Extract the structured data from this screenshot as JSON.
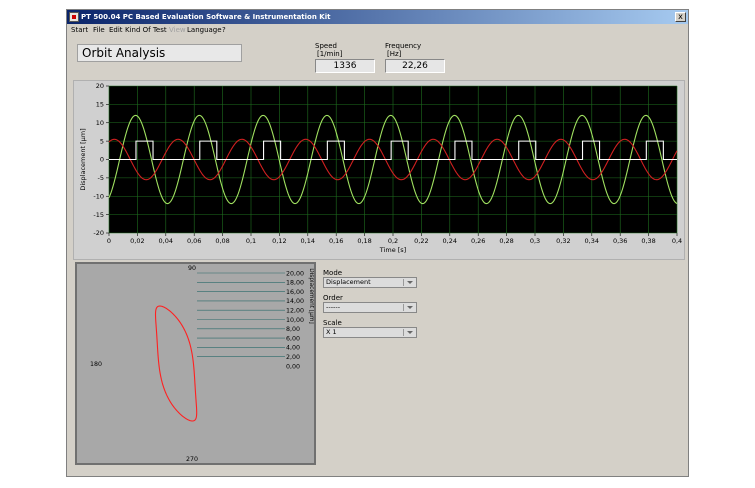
{
  "window": {
    "title": "PT 500.04 PC Based Evaluation Software & Instrumentation Kit",
    "close_label": "x"
  },
  "menu": [
    "Start",
    "File",
    "Edit",
    "Kind Of Test",
    "View",
    "Language",
    "?"
  ],
  "page_title": "Orbit Analysis",
  "indicators": {
    "speed": {
      "label": "Speed",
      "unit": "[1/min]",
      "value": "1336"
    },
    "frequency": {
      "label": "Frequency",
      "unit": "[Hz]",
      "value": "22,26"
    }
  },
  "controls": {
    "mode": {
      "label": "Mode",
      "value": "Displacement"
    },
    "order": {
      "label": "Order",
      "value": "------"
    },
    "scale": {
      "label": "Scale",
      "value": "X  1"
    }
  },
  "colors": {
    "plot_bg": "#000000",
    "grid": "#1f6f1f",
    "series_green": "#a0e060",
    "series_red": "#d02020",
    "series_white": "#ffffff",
    "orbit": "#ff2020"
  },
  "chart_data": [
    {
      "type": "line",
      "xlabel": "Time [s]",
      "ylabel": "Displacement [µm]",
      "xlim": [
        0,
        0.4
      ],
      "ylim": [
        -20,
        20
      ],
      "x_ticks": [
        "0",
        "0,02",
        "0,04",
        "0,06",
        "0,08",
        "0,1",
        "0,12",
        "0,14",
        "0,16",
        "0,18",
        "0,2",
        "0,22",
        "0,24",
        "0,26",
        "0,28",
        "0,3",
        "0,32",
        "0,34",
        "0,36",
        "0,38",
        "0,4"
      ],
      "y_ticks": [
        "20",
        "15",
        "10",
        "5",
        "0",
        "-5",
        "-10",
        "-15",
        "-20"
      ],
      "grid": true,
      "series": [
        {
          "color": "#a0e060",
          "kind": "sine",
          "amplitude": 12,
          "frequency_hz": 22.26,
          "phase_deg": -60
        },
        {
          "color": "#d02020",
          "kind": "sine",
          "amplitude": 5.5,
          "frequency_hz": 22.26,
          "phase_deg": 60
        },
        {
          "color": "#ffffff",
          "kind": "pulse",
          "high": 5,
          "low": 0,
          "frequency_hz": 22.26,
          "pulse_width_s": 0.012,
          "first_rise_s": 0.019
        }
      ]
    },
    {
      "type": "polar",
      "ylabel": "Displacement [µm]",
      "angle_labels": [
        "90",
        "180",
        "270"
      ],
      "radial_ticks": [
        "20,00",
        "18,00",
        "16,00",
        "14,00",
        "12,00",
        "10,00",
        "8,00",
        "6,00",
        "4,00",
        "2,00",
        "0,00"
      ],
      "series": [
        {
          "color": "#ff2020",
          "kind": "orbit-loop",
          "x_range": [
            -12,
            3
          ],
          "y_range": [
            -12,
            11
          ]
        }
      ]
    }
  ]
}
